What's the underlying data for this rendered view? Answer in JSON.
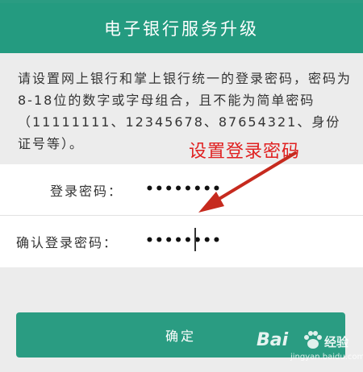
{
  "header": {
    "title": "电子银行服务升级"
  },
  "notice": {
    "text": "请设置网上银行和掌上银行统一的登录密码，密码为8-18位的数字或字母组合，且不能为简单密码（11111111、12345678、87654321、身份证号等）。"
  },
  "form": {
    "password_label": "登录密码：",
    "password_value": "••••••••",
    "confirm_label": "确认登录密码：",
    "confirm_value": "••••••••"
  },
  "annotation": {
    "text": "设置登录密码",
    "color": "#e02020"
  },
  "confirm_button": {
    "label": "确定"
  },
  "watermark": {
    "brand": "Bai",
    "word": "经验",
    "url": "jingyan.baidu.com"
  },
  "colors": {
    "accent": "#249b80",
    "background": "#ececec"
  },
  "icons": {
    "arrow": "annotation-arrow-icon",
    "paw": "paw-icon"
  }
}
